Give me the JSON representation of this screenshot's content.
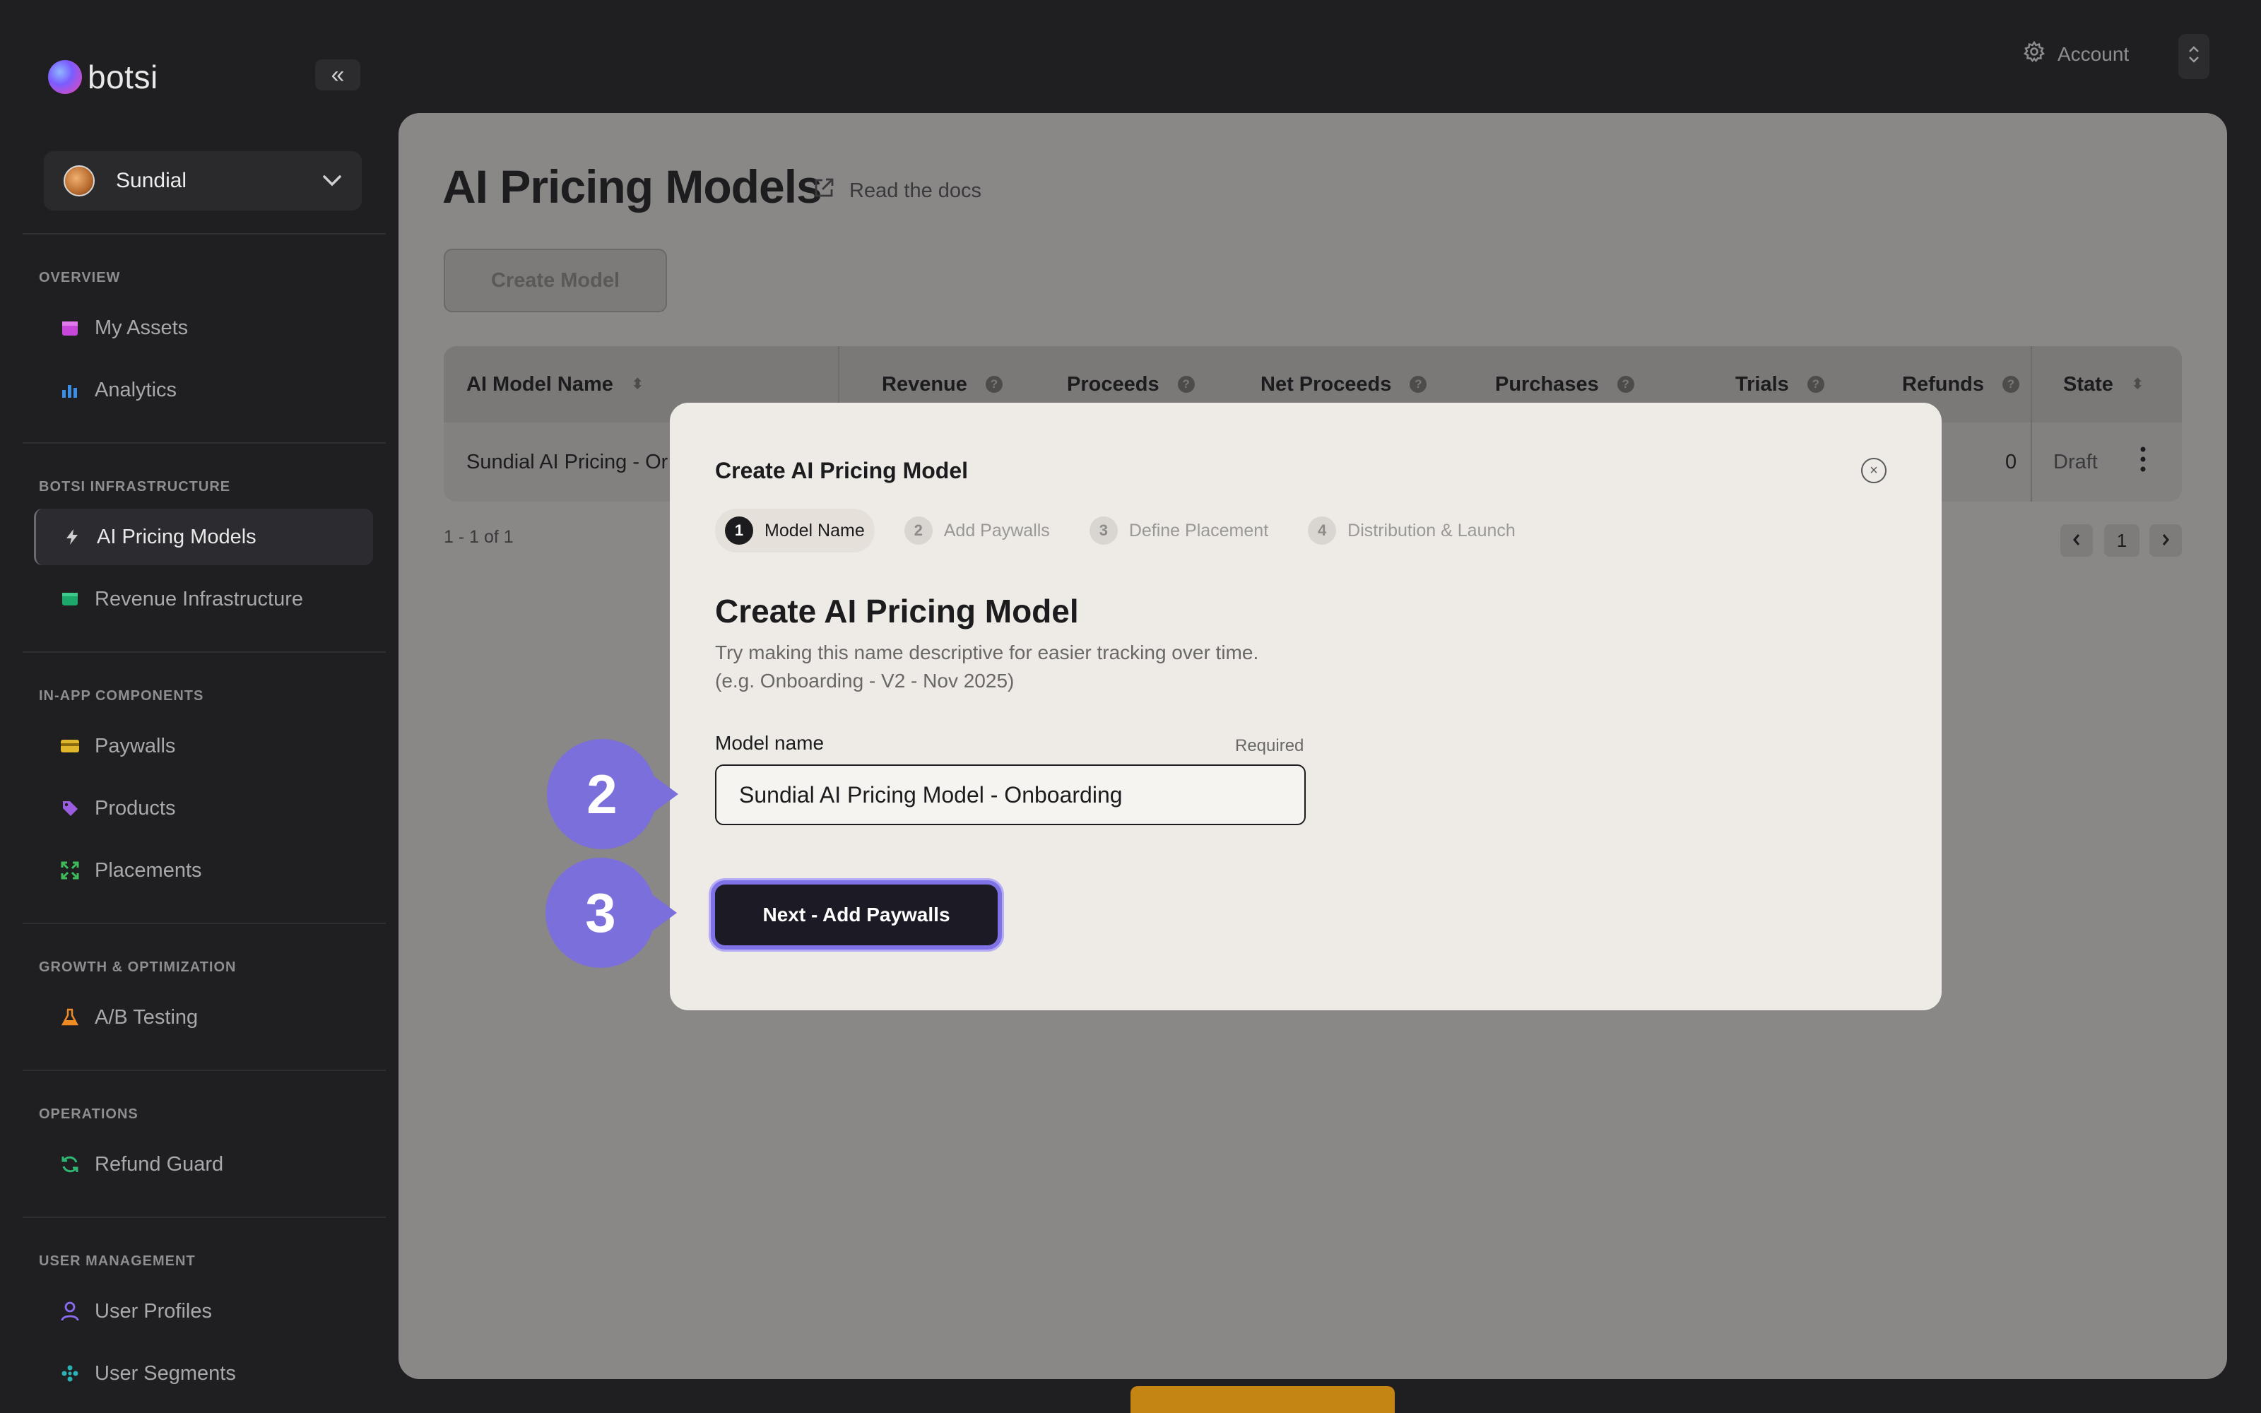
{
  "sidebar": {
    "brand": "botsi",
    "collapse_icon": "«",
    "workspace": {
      "name": "Sundial"
    },
    "sections": [
      {
        "label": "OVERVIEW",
        "items": [
          {
            "label": "My Assets",
            "icon": "assets-icon",
            "color": "#c548d8"
          },
          {
            "label": "Analytics",
            "icon": "bar-chart-icon",
            "color": "#3a8ee6"
          }
        ]
      },
      {
        "label": "BOTSI INFRASTRUCTURE",
        "items": [
          {
            "label": "AI Pricing Models",
            "icon": "bolt-icon",
            "color": "#cfcfd2",
            "active": true
          },
          {
            "label": "Revenue Infrastructure",
            "icon": "server-icon",
            "color": "#1ea76a"
          }
        ]
      },
      {
        "label": "IN-APP COMPONENTS",
        "items": [
          {
            "label": "Paywalls",
            "icon": "card-icon",
            "color": "#e0b62a"
          },
          {
            "label": "Products",
            "icon": "tag-icon",
            "color": "#9a5de0"
          },
          {
            "label": "Placements",
            "icon": "expand-icon",
            "color": "#3dbb5a"
          }
        ]
      },
      {
        "label": "GROWTH & OPTIMIZATION",
        "items": [
          {
            "label": "A/B Testing",
            "icon": "flask-icon",
            "color": "#f08a24"
          }
        ]
      },
      {
        "label": "OPERATIONS",
        "items": [
          {
            "label": "Refund Guard",
            "icon": "refresh-icon",
            "color": "#2eb673"
          }
        ]
      },
      {
        "label": "USER MANAGEMENT",
        "items": [
          {
            "label": "User Profiles",
            "icon": "user-icon",
            "color": "#8a6cf0"
          },
          {
            "label": "User Segments",
            "icon": "segments-icon",
            "color": "#2bb0b6"
          }
        ]
      }
    ]
  },
  "topbar": {
    "account_label": "Account"
  },
  "main": {
    "title": "AI Pricing Models",
    "docs_label": "Read the docs",
    "create_button": "Create Model",
    "table": {
      "columns": [
        "AI Model Name",
        "Revenue",
        "Proceeds",
        "Net Proceeds",
        "Purchases",
        "Trials",
        "Refunds",
        "State"
      ],
      "row": {
        "name": "Sundial AI Pricing - Or",
        "refunds": "0",
        "state": "Draft"
      }
    },
    "pagination": {
      "summary": "1 - 1 of 1",
      "page": "1"
    }
  },
  "modal": {
    "title": "Create AI Pricing Model",
    "steps": [
      {
        "num": "1",
        "label": "Model Name"
      },
      {
        "num": "2",
        "label": "Add Paywalls"
      },
      {
        "num": "3",
        "label": "Define Placement"
      },
      {
        "num": "4",
        "label": "Distribution & Launch"
      }
    ],
    "heading": "Create AI Pricing Model",
    "help_line1": "Try making this name descriptive for easier tracking over time.",
    "help_line2": "(e.g. Onboarding - V2 - Nov 2025)",
    "field_label": "Model name",
    "field_required": "Required",
    "field_value": "Sundial AI Pricing Model - Onboarding",
    "next_button": "Next - Add Paywalls"
  },
  "callouts": {
    "first": "2",
    "second": "3",
    "color": "#7b6fdc"
  }
}
